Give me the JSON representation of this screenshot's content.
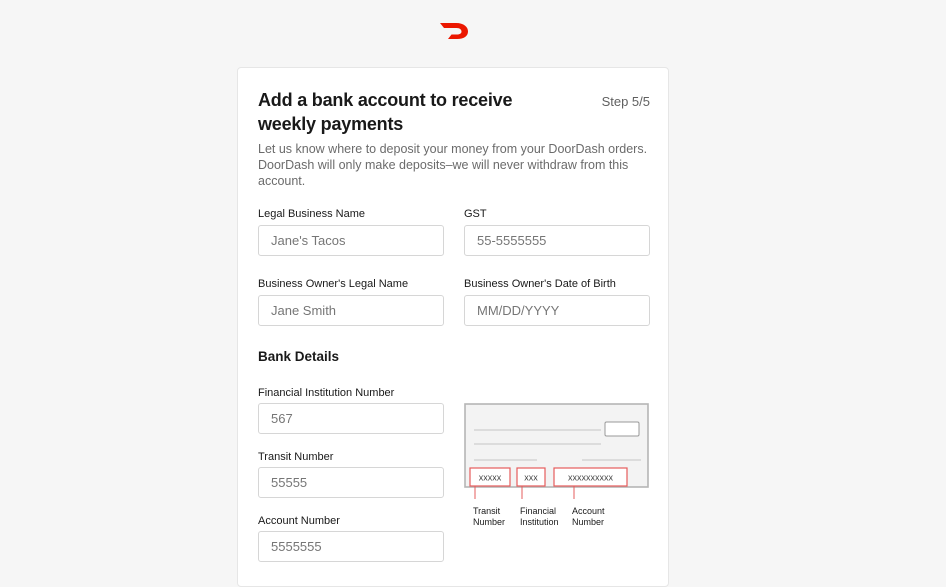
{
  "brand": {
    "logo_icon": "doordash-logo-icon",
    "accent_color": "#eb1700"
  },
  "header": {
    "title": "Add a bank account to receive weekly payments",
    "step": "Step 5/5",
    "description": "Let us know where to deposit your money from your DoorDash orders. DoorDash will only make deposits–we will never withdraw from this account."
  },
  "form": {
    "legal_business_name": {
      "label": "Legal Business Name",
      "placeholder": "Jane's Tacos"
    },
    "gst": {
      "label": "GST",
      "placeholder": "55-5555555"
    },
    "owner_legal_name": {
      "label": "Business Owner's Legal Name",
      "placeholder": "Jane Smith"
    },
    "owner_dob": {
      "label": "Business Owner's Date of Birth",
      "placeholder": "MM/DD/YYYY"
    }
  },
  "bank": {
    "title": "Bank Details",
    "financial_institution_number": {
      "label": "Financial Institution Number",
      "placeholder": "567"
    },
    "transit_number": {
      "label": "Transit Number",
      "placeholder": "55555"
    },
    "account_number": {
      "label": "Account Number",
      "placeholder": "5555555"
    }
  },
  "cheque": {
    "transit_code": "xxxxx",
    "institution_code": "xxx",
    "account_code": "xxxxxxxxxx",
    "transit_caption": [
      "Transit",
      "Number"
    ],
    "institution_caption": [
      "Financial",
      "Institution"
    ],
    "account_caption": [
      "Account",
      "Number"
    ]
  }
}
